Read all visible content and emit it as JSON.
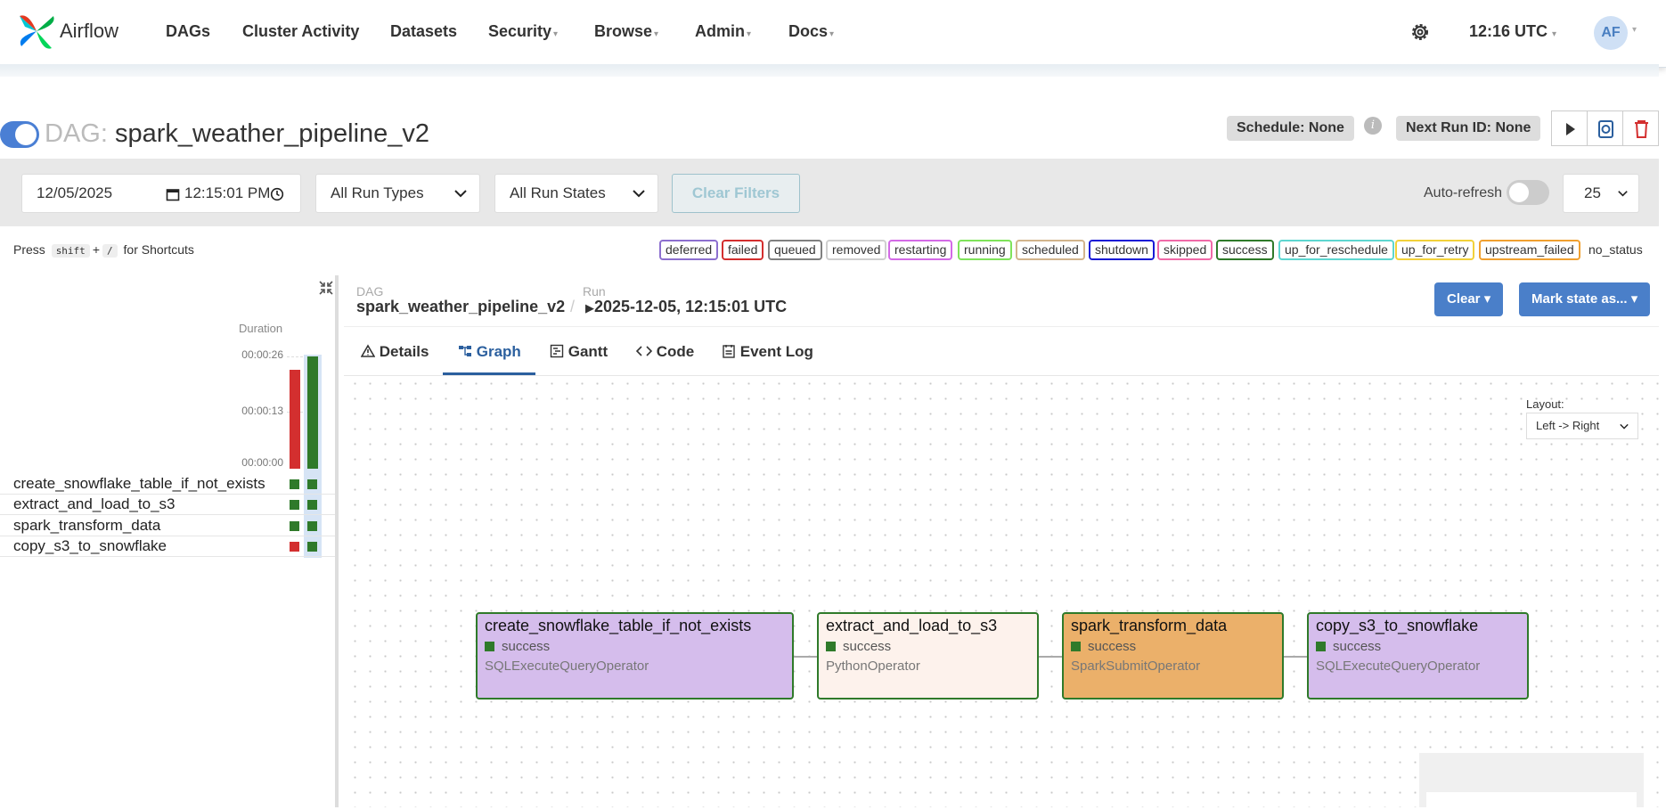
{
  "app": {
    "brand": "Airflow"
  },
  "nav": {
    "items": [
      {
        "label": "DAGs",
        "dropdown": false
      },
      {
        "label": "Cluster Activity",
        "dropdown": false
      },
      {
        "label": "Datasets",
        "dropdown": false
      },
      {
        "label": "Security",
        "dropdown": true
      },
      {
        "label": "Browse",
        "dropdown": true
      },
      {
        "label": "Admin",
        "dropdown": true
      },
      {
        "label": "Docs",
        "dropdown": true
      }
    ],
    "caret": "▾",
    "time": "12:16 UTC",
    "avatar": "AF"
  },
  "dag": {
    "prefix": "DAG:",
    "name": "spark_weather_pipeline_v2",
    "schedule": "Schedule: None",
    "info": "i",
    "next_run": "Next Run ID: None"
  },
  "filters": {
    "date": "12/05/2025",
    "time": "12:15:01 PM",
    "run_types": "All Run Types",
    "run_states": "All Run States",
    "clear_filters": "Clear Filters",
    "auto_refresh": "Auto-refresh",
    "page_size": "25"
  },
  "shortcut": {
    "press": "Press",
    "key1": "shift",
    "plus": "+",
    "key2": "/",
    "suffix": "for Shortcuts"
  },
  "legend": [
    {
      "label": "deferred",
      "color": "#8c6fcf"
    },
    {
      "label": "failed",
      "color": "#d32f2f"
    },
    {
      "label": "queued",
      "color": "#808080"
    },
    {
      "label": "removed",
      "color": "#cfcfcf"
    },
    {
      "label": "restarting",
      "color": "#d36ae6"
    },
    {
      "label": "running",
      "color": "#7fe35a"
    },
    {
      "label": "scheduled",
      "color": "#d2b48c"
    },
    {
      "label": "shutdown",
      "color": "#1a1ad6"
    },
    {
      "label": "skipped",
      "color": "#f06aa8"
    },
    {
      "label": "success",
      "color": "#2f7a2a"
    },
    {
      "label": "up_for_reschedule",
      "color": "#5ed6d0"
    },
    {
      "label": "up_for_retry",
      "color": "#f2d13a"
    },
    {
      "label": "upstream_failed",
      "color": "#f0a030"
    },
    {
      "label": "no_status",
      "color": "none"
    }
  ],
  "grid": {
    "duration_title": "Duration",
    "ticks": [
      "00:00:26",
      "00:00:13",
      "00:00:00"
    ],
    "runs": [
      {
        "duration_sec": 23,
        "color": "#d32f2f"
      },
      {
        "duration_sec": 26,
        "color": "#2f7a2a"
      }
    ],
    "tasks": [
      {
        "name": "create_snowflake_table_if_not_exists",
        "states": [
          "#2f7a2a",
          "#2f7a2a"
        ]
      },
      {
        "name": "extract_and_load_to_s3",
        "states": [
          "#2f7a2a",
          "#2f7a2a"
        ]
      },
      {
        "name": "spark_transform_data",
        "states": [
          "#2f7a2a",
          "#2f7a2a"
        ]
      },
      {
        "name": "copy_s3_to_snowflake",
        "states": [
          "#d32f2f",
          "#2f7a2a"
        ]
      }
    ]
  },
  "breadcrumb": {
    "dag_label": "DAG",
    "dag_value": "spark_weather_pipeline_v2",
    "sep": "/",
    "run_label": "Run",
    "run_value": "2025-12-05, 12:15:01 UTC"
  },
  "actions": {
    "clear": "Clear",
    "mark_state": "Mark state as..."
  },
  "tabs": [
    {
      "label": "Details",
      "icon": "warning-icon"
    },
    {
      "label": "Graph",
      "icon": "graph-icon",
      "active": true
    },
    {
      "label": "Gantt",
      "icon": "gantt-icon"
    },
    {
      "label": "Code",
      "icon": "code-icon"
    },
    {
      "label": "Event Log",
      "icon": "event-log-icon"
    }
  ],
  "graph": {
    "layout_label": "Layout:",
    "layout_value": "Left -> Right",
    "nodes": [
      {
        "name": "create_snowflake_table_if_not_exists",
        "state": "success",
        "operator": "SQLExecuteQueryOperator",
        "color": "#d5bdec"
      },
      {
        "name": "extract_and_load_to_s3",
        "state": "success",
        "operator": "PythonOperator",
        "color": "#fdf2ec"
      },
      {
        "name": "spark_transform_data",
        "state": "success",
        "operator": "SparkSubmitOperator",
        "color": "#ebb06a"
      },
      {
        "name": "copy_s3_to_snowflake",
        "state": "success",
        "operator": "SQLExecuteQueryOperator",
        "color": "#d5bdec"
      }
    ]
  }
}
